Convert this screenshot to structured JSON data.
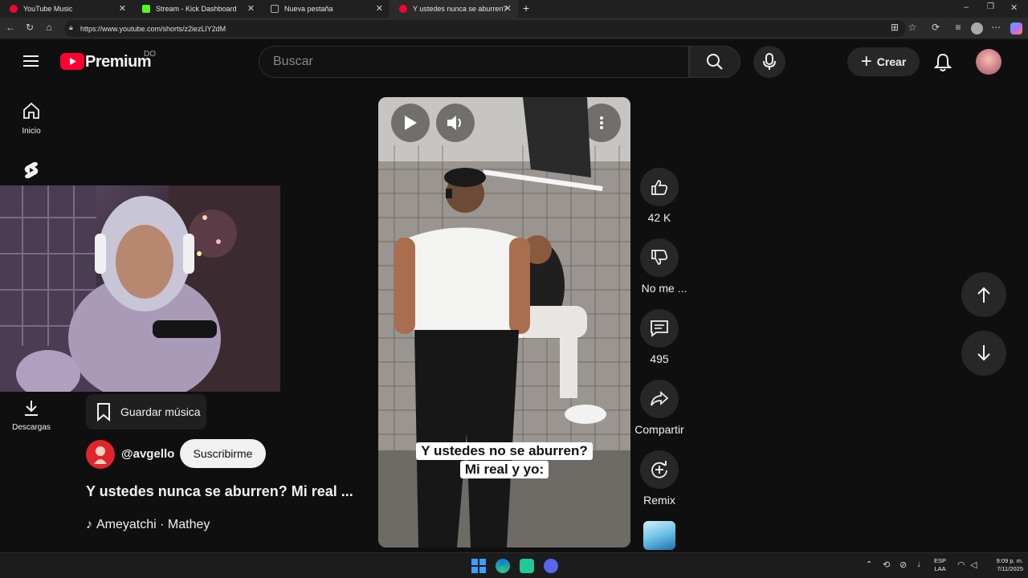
{
  "browser": {
    "tabs": [
      {
        "label": "YouTube Music",
        "color": "#ff0033"
      },
      {
        "label": "Stream - Kick Dashboard",
        "color": "#53fc18"
      },
      {
        "label": "Nueva pestaña",
        "color": "#aaaaaa"
      },
      {
        "label": "Y ustedes nunca se aburren? Mi r",
        "color": "#ff0033"
      }
    ],
    "url": "https://www.youtube.com/shorts/z2iezLlY2dM"
  },
  "header": {
    "logo_text": "Premium",
    "country": "DO",
    "search_placeholder": "Buscar",
    "create_label": "Crear"
  },
  "sidebar": {
    "home_label": "Inicio",
    "downloads_label": "Descargas"
  },
  "short": {
    "caption_line1": "Y ustedes no se aburren?",
    "caption_line2": "Mi real y yo:",
    "save_music_label": "Guardar música",
    "channel_handle": "@avgello",
    "subscribe_label": "Suscribirme",
    "title": "Y ustedes nunca se aburren? Mi real ...",
    "music": "Ameyatchi · Mathey"
  },
  "actions": {
    "likes": "42 K",
    "dislike_label": "No me ...",
    "comments": "495",
    "share_label": "Compartir",
    "remix_label": "Remix"
  },
  "taskbar": {
    "lang": "ESP",
    "lang2": "LAA",
    "time": "9:09 p. m.",
    "date": "7/11/2025"
  },
  "colors": {
    "brand_red": "#ff0033",
    "background": "#0f0f0f",
    "button": "#272727"
  }
}
